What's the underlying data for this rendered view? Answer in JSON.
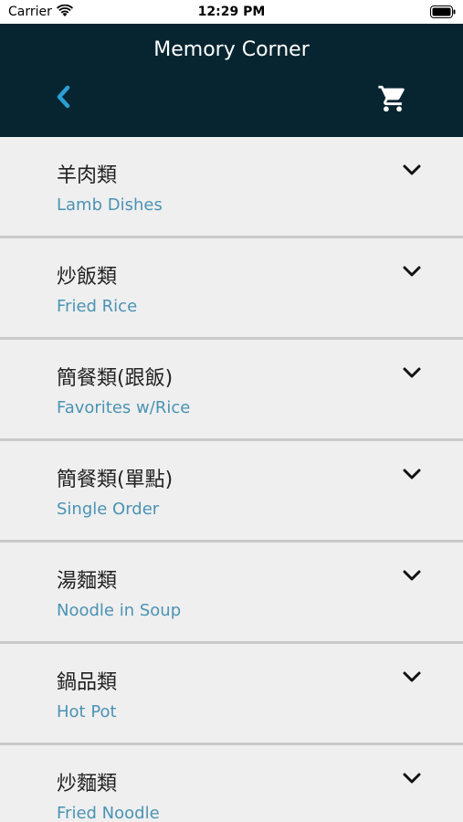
{
  "status": {
    "carrier": "Carrier",
    "time": "12:29 PM"
  },
  "header": {
    "title": "Memory Corner",
    "back_icon": "chevron-left-icon",
    "cart_icon": "cart-icon",
    "accent_color": "#2a9fd6",
    "background_color": "#062530"
  },
  "categories": [
    {
      "name_zh": "羊肉類",
      "name_en": "Lamb Dishes"
    },
    {
      "name_zh": "炒飯類",
      "name_en": "Fried Rice"
    },
    {
      "name_zh": "簡餐類(跟飯)",
      "name_en": "Favorites w/Rice"
    },
    {
      "name_zh": "簡餐類(單點)",
      "name_en": "Single Order"
    },
    {
      "name_zh": "湯麵類",
      "name_en": "Noodle in Soup"
    },
    {
      "name_zh": "鍋品類",
      "name_en": "Hot Pot"
    },
    {
      "name_zh": "炒麵類",
      "name_en": "Fried Noodle"
    }
  ]
}
